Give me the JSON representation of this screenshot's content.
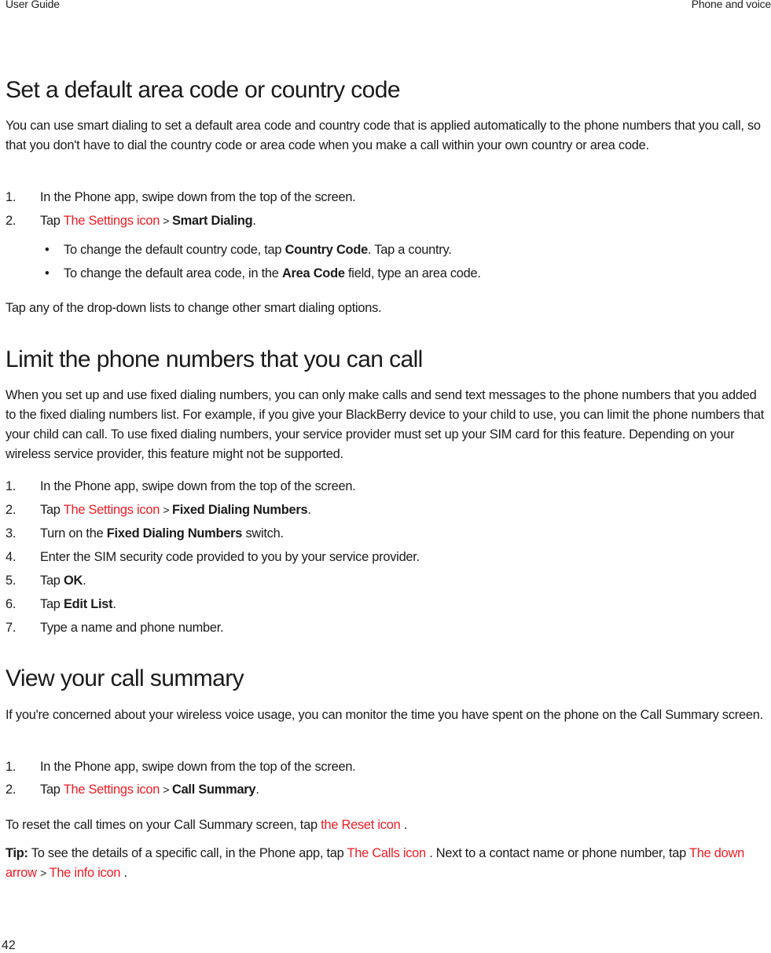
{
  "header": {
    "left": "User Guide",
    "right": "Phone and voice"
  },
  "footer": {
    "page_number": "42"
  },
  "accent_color": "#ee1c24",
  "sections": [
    {
      "title": "Set a default area code or country code",
      "intro": "You can use smart dialing to set a default area code and country code that is applied automatically to the phone numbers that you call, so that you don't have to dial the country code or area code when you make a call within your own country or area code.",
      "steps": [
        {
          "num": "1.",
          "text": "In the Phone app, swipe down from the top of the screen."
        },
        {
          "num": "2.",
          "pre": "Tap ",
          "icon": "The Settings icon",
          "sep": " > ",
          "bold": "Smart Dialing",
          "post": "."
        }
      ],
      "bullets": [
        {
          "pre": "To change the default country code, tap ",
          "bold": "Country Code",
          "post": ". Tap a country."
        },
        {
          "pre": "To change the default area code, in the ",
          "bold": "Area Code",
          "post": " field, type an area code."
        }
      ],
      "outro": "Tap any of the drop-down lists to change other smart dialing options."
    },
    {
      "title": "Limit the phone numbers that you can call",
      "intro": "When you set up and use fixed dialing numbers, you can only make calls and send text messages to the phone numbers that you added to the fixed dialing numbers list. For example, if you give your BlackBerry device to your child to use, you can limit the phone numbers that your child can call. To use fixed dialing numbers, your service provider must set up your SIM card for this feature. Depending on your wireless service provider, this feature might not be supported.",
      "steps": [
        {
          "num": "1.",
          "text": "In the Phone app, swipe down from the top of the screen."
        },
        {
          "num": "2.",
          "pre": "Tap ",
          "icon": "The Settings icon",
          "sep": " > ",
          "bold": "Fixed Dialing Numbers",
          "post": "."
        },
        {
          "num": "3.",
          "pre": "Turn on the ",
          "bold": "Fixed Dialing Numbers",
          "post": " switch."
        },
        {
          "num": "4.",
          "text": "Enter the SIM security code provided to you by your service provider."
        },
        {
          "num": "5.",
          "pre": "Tap ",
          "bold": "OK",
          "post": "."
        },
        {
          "num": "6.",
          "pre": "Tap ",
          "bold": "Edit List",
          "post": "."
        },
        {
          "num": "7.",
          "text": "Type a name and phone number."
        }
      ]
    },
    {
      "title": "View your call summary",
      "intro": "If you're concerned about your wireless voice usage, you can monitor the time you have spent on the phone on the Call Summary screen.",
      "steps": [
        {
          "num": "1.",
          "text": "In the Phone app, swipe down from the top of the screen."
        },
        {
          "num": "2.",
          "pre": "Tap ",
          "icon": "The Settings icon",
          "sep": " > ",
          "bold": "Call Summary",
          "post": "."
        }
      ],
      "reset_note": {
        "pre": "To reset the call times on your Call Summary screen, tap ",
        "icon": "the Reset icon",
        "post": " ."
      },
      "tip": {
        "label": "Tip:",
        "pre": " To see the details of a specific call, in the Phone app, tap ",
        "icon1": "The Calls icon",
        "mid": " . Next to a contact name or phone number, tap ",
        "icon2": "The down arrow",
        "sep": " > ",
        "icon3": "The info icon",
        "post": " ."
      }
    }
  ]
}
